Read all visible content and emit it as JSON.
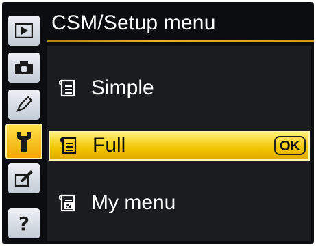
{
  "header": {
    "title": "CSM/Setup menu"
  },
  "tabs": [
    {
      "name": "playback-icon",
      "active": false
    },
    {
      "name": "camera-icon",
      "active": false
    },
    {
      "name": "pencil-icon",
      "active": false
    },
    {
      "name": "wrench-icon",
      "active": true
    },
    {
      "name": "retouch-icon",
      "active": false
    },
    {
      "name": "help-icon",
      "active": false,
      "glyph": "?"
    }
  ],
  "menu": {
    "items": [
      {
        "label": "Simple",
        "icon": "menu-list-icon",
        "selected": false
      },
      {
        "label": "Full",
        "icon": "menu-list-icon",
        "selected": true,
        "badge": "OK"
      },
      {
        "label": "My menu",
        "icon": "my-menu-icon",
        "selected": false
      }
    ]
  },
  "colors": {
    "accent": "#f2c400",
    "background": "#0c0d10",
    "panel": "#1b1c20",
    "rule": "#e8b428"
  }
}
